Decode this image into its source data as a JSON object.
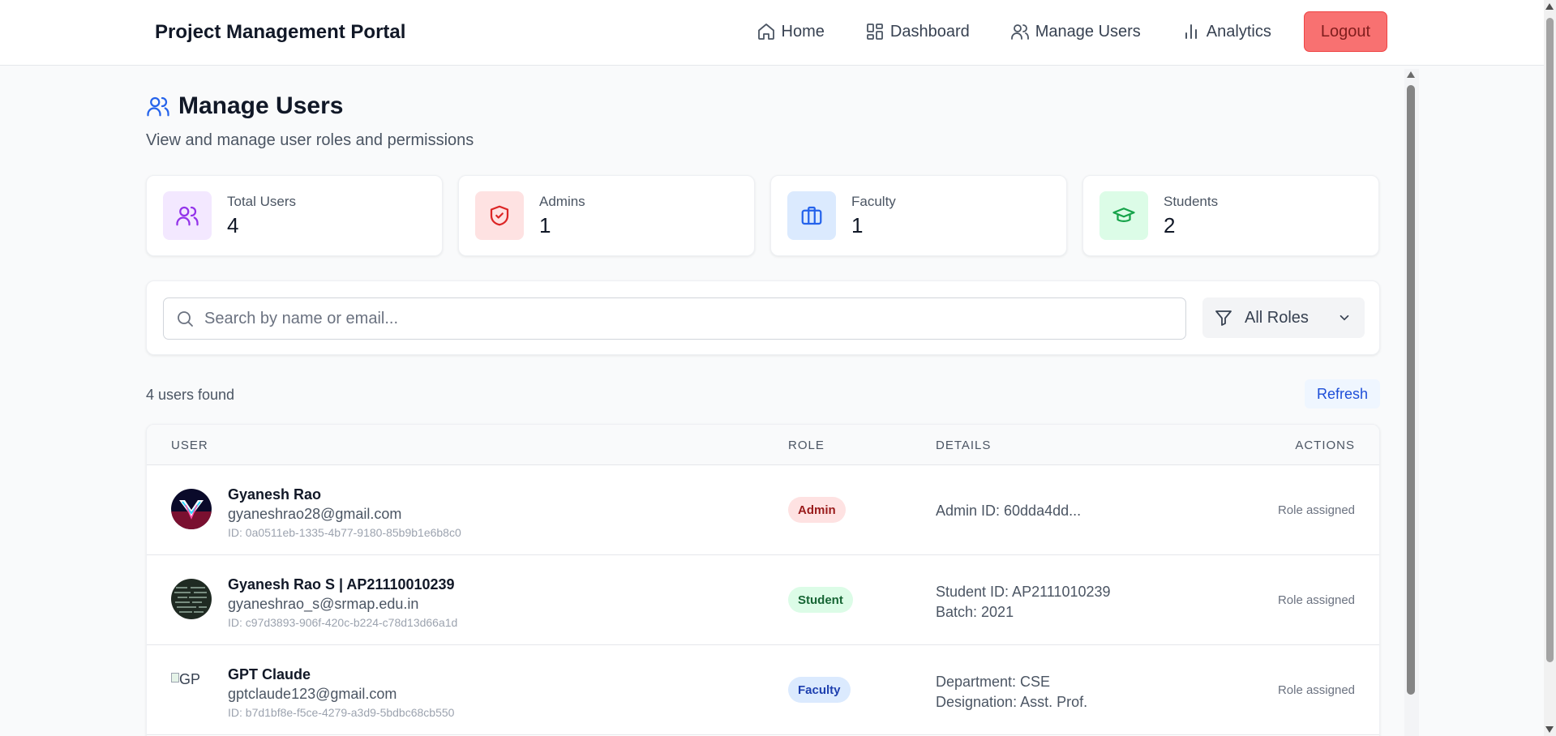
{
  "navbar": {
    "brand": "Project Management Portal",
    "links": [
      {
        "label": "Home",
        "icon": "home-icon"
      },
      {
        "label": "Dashboard",
        "icon": "dashboard-icon"
      },
      {
        "label": "Manage Users",
        "icon": "users-icon"
      },
      {
        "label": "Analytics",
        "icon": "bar-chart-icon"
      }
    ],
    "logout_label": "Logout"
  },
  "header": {
    "title": "Manage Users",
    "subtitle": "View and manage user roles and permissions"
  },
  "stats": [
    {
      "label": "Total Users",
      "value": "4",
      "icon": "users-icon",
      "bg": "#f3e8ff",
      "color": "#9333ea"
    },
    {
      "label": "Admins",
      "value": "1",
      "icon": "shield-icon",
      "bg": "#fee2e2",
      "color": "#dc2626"
    },
    {
      "label": "Faculty",
      "value": "1",
      "icon": "briefcase-icon",
      "bg": "#dbeafe",
      "color": "#2563eb"
    },
    {
      "label": "Students",
      "value": "2",
      "icon": "graduation-cap-icon",
      "bg": "#dcfce7",
      "color": "#16a34a"
    }
  ],
  "search": {
    "placeholder": "Search by name or email...",
    "value": "",
    "role_filter": "All Roles"
  },
  "results": {
    "count_text": "4 users found",
    "refresh_label": "Refresh"
  },
  "table": {
    "columns": [
      "USER",
      "ROLE",
      "DETAILS",
      "ACTIONS"
    ],
    "rows": [
      {
        "name": "Gyanesh Rao",
        "email": "gyaneshrao28@gmail.com",
        "id": "ID: 0a0511eb-1335-4b77-9180-85b9b1e6b8c0",
        "role": "Admin",
        "details": [
          "Admin ID: 60dda4dd..."
        ],
        "action": "Role assigned"
      },
      {
        "name": "Gyanesh Rao S | AP21110010239",
        "email": "gyaneshrao_s@srmap.edu.in",
        "id": "ID: c97d3893-906f-420c-b224-c78d13d66a1d",
        "role": "Student",
        "details": [
          "Student ID: AP2111010239",
          "Batch: 2021"
        ],
        "action": "Role assigned"
      },
      {
        "name": "GPT Claude",
        "email": "gptclaude123@gmail.com",
        "id": "ID: b7d1bf8e-f5ce-4279-a3d9-5bdbc68cb550",
        "role": "Faculty",
        "avatar_alt": "GP",
        "details": [
          "Department: CSE",
          "Designation: Asst. Prof."
        ],
        "action": "Role assigned"
      }
    ]
  },
  "colors": {
    "admin_badge_bg": "#fee2e2",
    "admin_badge_fg": "#991b1b",
    "student_badge_bg": "#dcfce7",
    "student_badge_fg": "#166534",
    "faculty_badge_bg": "#dbeafe",
    "faculty_badge_fg": "#1e40af",
    "logout_bg": "#f87171"
  }
}
